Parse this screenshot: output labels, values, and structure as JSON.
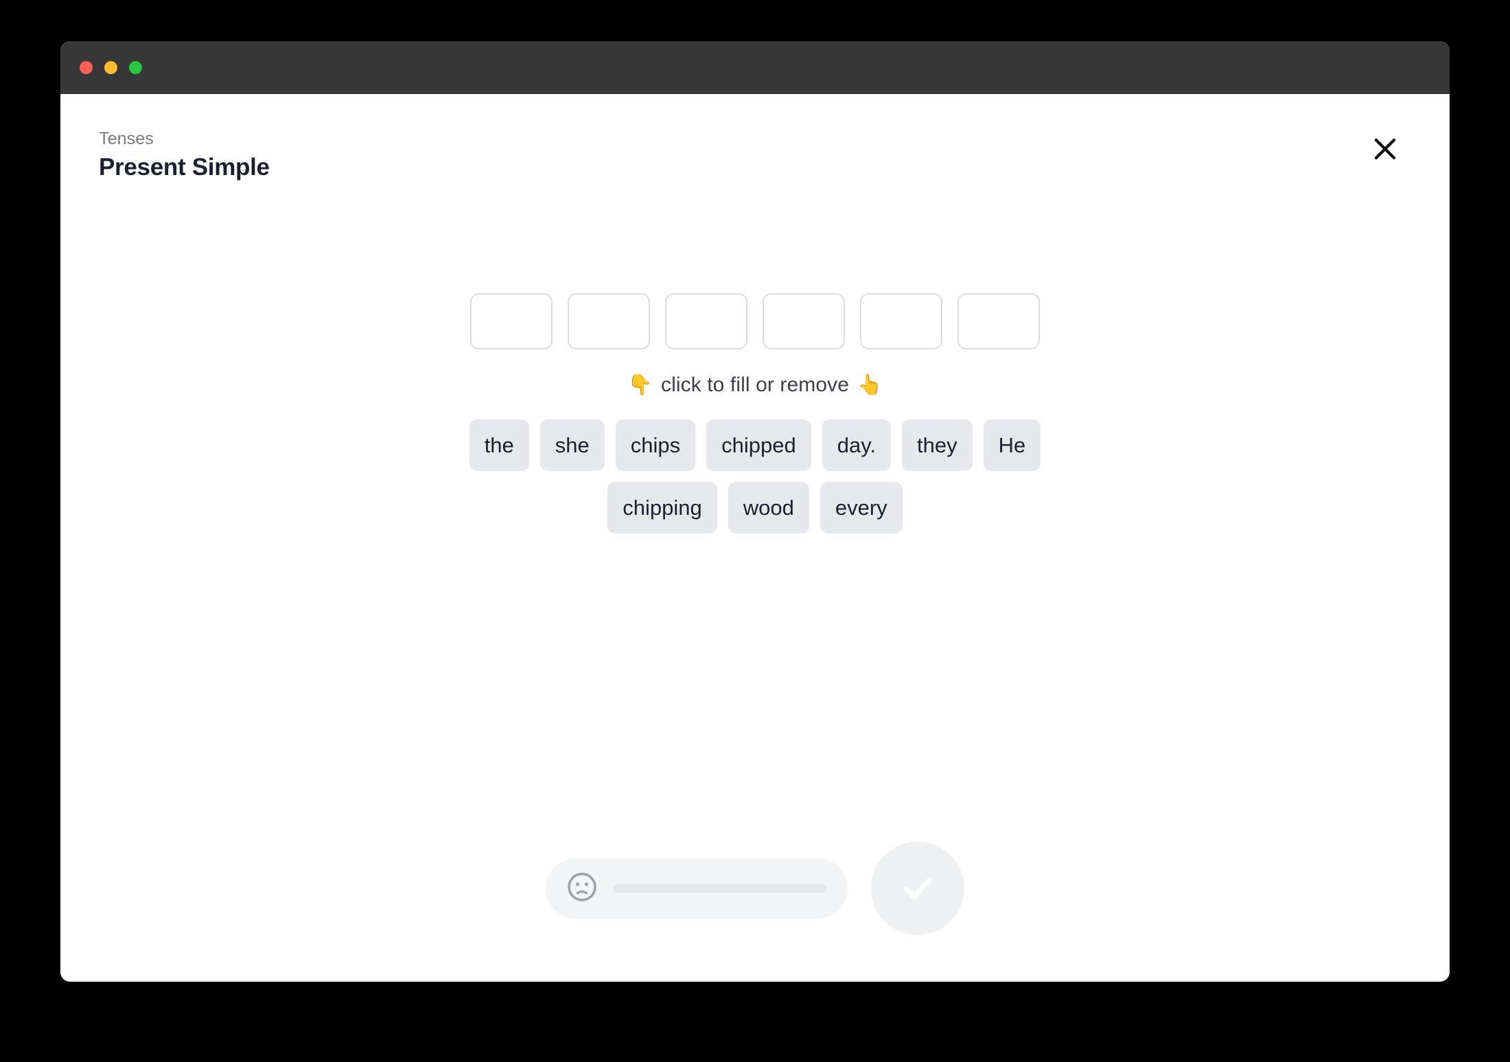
{
  "window": {
    "traffic_lights": [
      {
        "name": "close",
        "color": "#ff6159"
      },
      {
        "name": "minimize",
        "color": "#febc2e"
      },
      {
        "name": "zoom",
        "color": "#28c840"
      }
    ]
  },
  "header": {
    "breadcrumb": "Tenses",
    "title": "Present Simple",
    "close_icon": "close-icon"
  },
  "exercise": {
    "slot_count": 6,
    "slots": [
      "",
      "",
      "",
      "",
      "",
      ""
    ],
    "hint": {
      "left_emoji": "👇",
      "text": "click to fill or remove",
      "right_emoji": "👆"
    },
    "word_rows": [
      [
        "the",
        "she",
        "chips",
        "chipped",
        "day.",
        "they",
        "He"
      ],
      [
        "chipping",
        "wood",
        "every"
      ]
    ]
  },
  "footer": {
    "feedback_icon": "neutral-face-icon",
    "submit_icon": "check-icon"
  },
  "colors": {
    "titlebar": "#373737",
    "page_background": "#000000",
    "window_background": "#ffffff",
    "chip_background": "#e6e8ec",
    "chip_text": "#1b2030",
    "slot_border": "#dadde0",
    "muted_text": "#77797e",
    "submit_background": "#eff0f2"
  }
}
